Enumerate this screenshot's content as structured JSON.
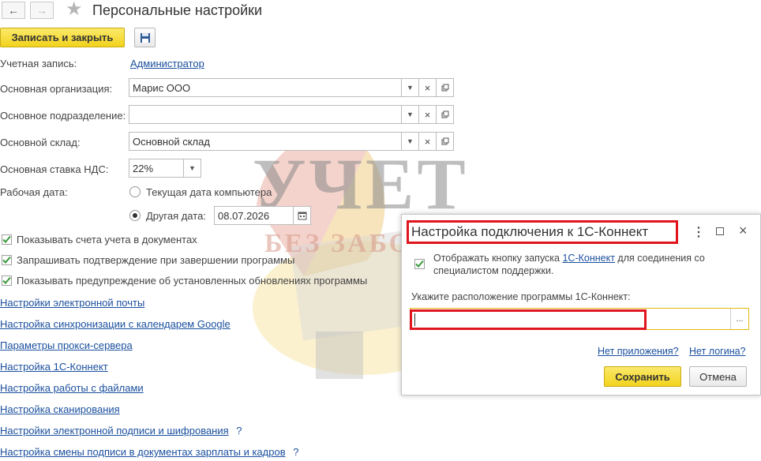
{
  "header": {
    "title": "Персональные настройки",
    "back_icon": "arrow-left-icon",
    "forward_icon": "arrow-right-icon",
    "favorite_icon": "star-icon"
  },
  "toolbar": {
    "save_close_label": "Записать и закрыть",
    "save_icon": "floppy-disk-icon"
  },
  "form": {
    "account_label": "Учетная запись:",
    "account_value": "Администратор",
    "org_label": "Основная организация:",
    "org_value": "Марис ООО",
    "dept_label": "Основное подразделение:",
    "dept_value": "",
    "warehouse_label": "Основной склад:",
    "warehouse_value": "Основной склад",
    "vat_label": "Основная ставка НДС:",
    "vat_value": "22%",
    "workdate_label": "Рабочая дата:",
    "radio_computer_date": "Текущая дата компьютера",
    "radio_other_date": "Другая дата:",
    "other_date_value": "08.07.2026",
    "selected_radio": "other"
  },
  "checkboxes": [
    {
      "label": "Показывать счета учета в документах",
      "checked": true
    },
    {
      "label": "Запрашивать подтверждение при завершении программы",
      "checked": true
    },
    {
      "label": "Показывать предупреждение об установленных обновлениях программы",
      "checked": true
    }
  ],
  "links": [
    {
      "label": "Настройки электронной почты"
    },
    {
      "label": "Настройка синхронизации с календарем Google"
    },
    {
      "label": "Параметры прокси-сервера"
    },
    {
      "label": "Настройка 1С-Коннект"
    },
    {
      "label": "Настройка работы с файлами"
    },
    {
      "label": "Настройка сканирования"
    },
    {
      "label": "Настройки электронной подписи и шифрования",
      "help": "?"
    },
    {
      "label": "Настройка смены подписи в документах зарплаты и кадров",
      "help": "?"
    }
  ],
  "watermark": {
    "line1": "УЧЕТ",
    "line2": "БЕЗ ЗАБОТ"
  },
  "dialog": {
    "title": "Настройка подключения к 1С-Коннект",
    "more_icon": "more-vertical-icon",
    "maximize_icon": "maximize-icon",
    "close_icon": "close-icon",
    "checkbox_checked": true,
    "checkbox_text_before": "Отображать кнопку запуска ",
    "checkbox_link": "1С-Коннект",
    "checkbox_text_after": " для соединения со",
    "checkbox_text_line2": "специалистом поддержки.",
    "path_label": "Укажите расположение программы 1С-Коннект:",
    "path_value": "",
    "browse_label": "...",
    "no_app_link": "Нет приложения?",
    "no_login_link": "Нет логина?",
    "save_label": "Сохранить",
    "cancel_label": "Отмена"
  },
  "colors": {
    "accent_yellow": "#f5d82a",
    "link_blue": "#1a4f9e",
    "highlight_red": "#e0151d",
    "check_green": "#3a9a3a"
  }
}
